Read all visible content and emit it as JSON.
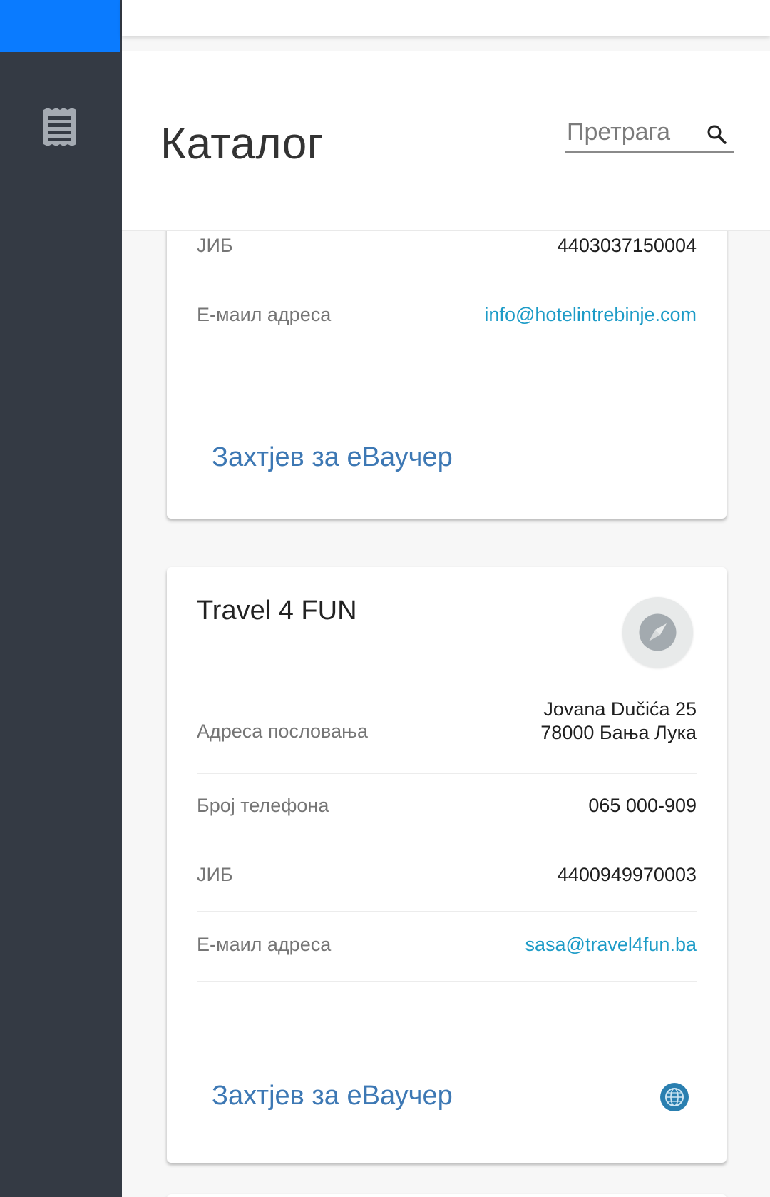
{
  "sidebar": {
    "menu_icon": "receipt-icon"
  },
  "header": {
    "title": "Каталог",
    "search": {
      "placeholder": "Претрага",
      "icon": "search-icon"
    }
  },
  "cards": [
    {
      "rows": [
        {
          "label": "ЈИБ",
          "value": "4403037150004"
        },
        {
          "label": "Е-маил адреса",
          "value": "info@hotelintrebinje.com"
        }
      ],
      "action_label": "Захтјев за еВаучер"
    },
    {
      "title": "Travel 4 FUN",
      "avatar_icon": "compass-icon",
      "address_label": "Адреса пословања",
      "address_line1": "Jovana Dučića 25",
      "address_line2": "78000 Бања Лука",
      "rows": [
        {
          "label": "Број телефона",
          "value": "065 000-909"
        },
        {
          "label": "ЈИБ",
          "value": "4400949970003"
        },
        {
          "label": "Е-маил адреса",
          "value": "sasa@travel4fun.ba"
        }
      ],
      "action_label": "Захтјев за еВаучер",
      "web_icon": "globe-icon"
    }
  ],
  "colors": {
    "sidebar": "#343a44",
    "accent": "#0a7bff",
    "link": "#1c9bc7",
    "action": "#3d78b4"
  }
}
